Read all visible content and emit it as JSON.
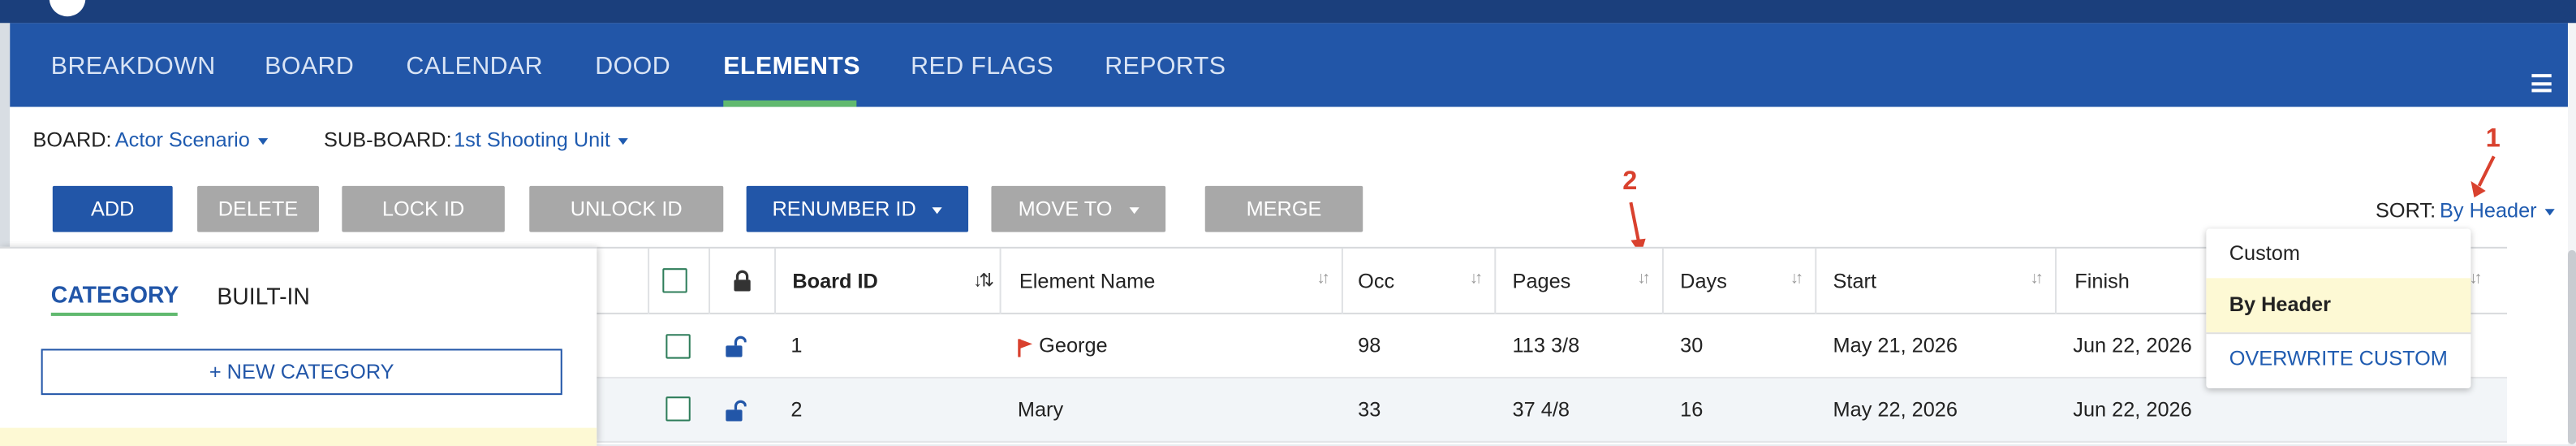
{
  "nav": {
    "tabs": [
      {
        "label": "BREAKDOWN"
      },
      {
        "label": "BOARD"
      },
      {
        "label": "CALENDAR"
      },
      {
        "label": "DOOD"
      },
      {
        "label": "ELEMENTS",
        "active": true
      },
      {
        "label": "RED FLAGS"
      },
      {
        "label": "REPORTS"
      }
    ],
    "menu_icon": "hamburger-icon"
  },
  "filters": {
    "board_label": "BOARD:",
    "board_value": "Actor Scenario",
    "subboard_label": "SUB-BOARD:",
    "subboard_value": "1st Shooting Unit"
  },
  "toolbar": {
    "add": "ADD",
    "delete": "DELETE",
    "lock_id": "LOCK ID",
    "unlock_id": "UNLOCK ID",
    "renumber_id": "RENUMBER ID",
    "move_to": "MOVE TO",
    "merge": "MERGE"
  },
  "sort": {
    "label": "SORT:",
    "value": "By Header",
    "options": [
      "Custom",
      "By Header",
      "OVERWRITE CUSTOM"
    ],
    "selected": "By Header"
  },
  "annotations": {
    "one": "1",
    "two": "2",
    "color": "#d9412e"
  },
  "category_panel": {
    "tab_category": "CATEGORY",
    "tab_builtin": "BUILT-IN",
    "new_category": "+ NEW CATEGORY"
  },
  "table": {
    "headers": {
      "board_id": "Board ID",
      "element_name": "Element Name",
      "occ": "Occ",
      "pages": "Pages",
      "days": "Days",
      "start": "Start",
      "finish": "Finish"
    },
    "rows": [
      {
        "board_id": "1",
        "name": "George",
        "flag": true,
        "occ": "98",
        "pages": "113 3/8",
        "days": "30",
        "start": "May 21, 2026",
        "finish": "Jun 22, 2026"
      },
      {
        "board_id": "2",
        "name": "Mary",
        "flag": false,
        "occ": "33",
        "pages": "37 4/8",
        "days": "16",
        "start": "May 22, 2026",
        "finish": "Jun 22, 2026"
      }
    ]
  },
  "colors": {
    "nav": "#2256a8",
    "accent": "#61b96f",
    "gray_button": "#a8a8a8",
    "highlight": "#fdf9d4"
  }
}
